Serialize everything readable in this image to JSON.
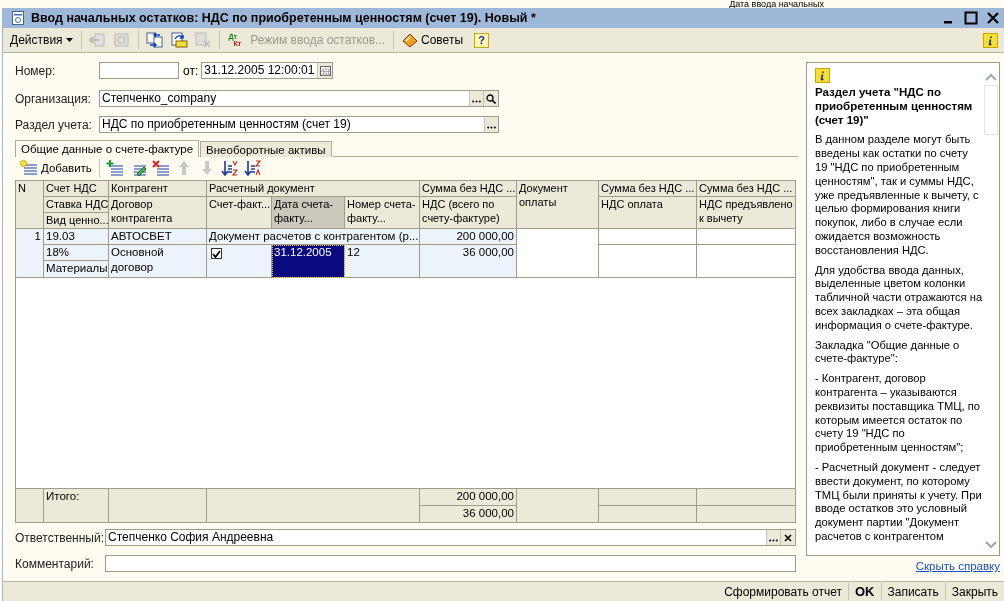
{
  "background_window": {
    "text": "Дата ввода начальных"
  },
  "window": {
    "title": "Ввод начальных остатков: НДС по приобретенным ценностям (счет 19). Новый *"
  },
  "toolbar": {
    "actions_menu": "Действия",
    "icon_buttons": [
      {
        "disabled": true
      },
      {
        "disabled": true
      },
      {
        "disabled": false
      },
      {
        "disabled": false
      },
      {
        "disabled": true
      }
    ],
    "posting_icon": [
      "Дт",
      "Кт"
    ],
    "mode_button": {
      "label": "Режим ввода остатков...",
      "disabled": true
    },
    "tips_button": "Советы",
    "help_button": "?"
  },
  "form": {
    "number": {
      "label": "Номер:"
    },
    "date": {
      "label": "от:",
      "value": "31.12.2005 12:00:01"
    },
    "organization": {
      "label": "Организация:",
      "value": "Степченко_company"
    },
    "section": {
      "label": "Раздел учета:",
      "value": "НДС по приобретенным ценностям (счет 19)"
    }
  },
  "tabs": [
    {
      "label": "Общие данные о счете-фактуре",
      "selected": true
    },
    {
      "label": "Внеоборотные активы",
      "selected": false
    }
  ],
  "table_toolbar": {
    "add_button": "Добавить",
    "icon_buttons": [
      {
        "disabled": false
      },
      {
        "disabled": false
      },
      {
        "disabled": false
      },
      {
        "disabled": true
      },
      {
        "disabled": true
      },
      {
        "disabled": false
      },
      {
        "disabled": false
      }
    ]
  },
  "table": {
    "header": [
      {
        "text": "N",
        "selected": false
      },
      {
        "text": "Счет НДС",
        "selected": false
      },
      {
        "text": "Контрагент",
        "selected": false
      },
      {
        "text": "Расчетный документ",
        "selected": false
      },
      {
        "text": "Сумма без НДС ...",
        "selected": false
      },
      {
        "text": "Документ оплаты",
        "selected": false
      },
      {
        "text": "Сумма без НДС ...",
        "selected": false
      },
      {
        "text": "Сумма без НДС ...",
        "selected": false
      },
      {
        "text": "Ставка НДС",
        "selected": false
      },
      {
        "text": "Вид ценно...",
        "selected": false
      },
      {
        "text": "Договор контрагента",
        "selected": false
      },
      {
        "text": "Счет-факт...",
        "selected": false
      },
      {
        "text": "Дата счета-факту...",
        "selected": true
      },
      {
        "text": "Номер счета-факту...",
        "selected": false
      },
      {
        "text": "НДС (всего по счету-фактуре)",
        "selected": false
      },
      {
        "text": "НДС оплата",
        "selected": false
      },
      {
        "text": "НДС предъявлено к вычету",
        "selected": false
      }
    ],
    "rows": [
      {
        "n": "1",
        "vat_account": "19.03",
        "vat_rate": "18%",
        "asset_type": "Материалы",
        "counterparty": "АВТОСВЕТ",
        "contract": "Основной договор",
        "settlement_document": "Документ расчетов с контрагентом (р...",
        "invoice_received": true,
        "invoice_date": {
          "text": "31.12.2005",
          "selected": true
        },
        "invoice_number": "12",
        "amount_without_vat": "200 000,00",
        "vat_total": "36 000,00"
      }
    ],
    "totals": {
      "label": "Итого:",
      "amount_without_vat": "200 000,00",
      "vat_total": "36 000,00"
    }
  },
  "responsible": {
    "label": "Ответственный:",
    "value": "Степченко София Андреевна"
  },
  "comment": {
    "label": "Комментарий:"
  },
  "help": {
    "title": "Раздел учета \"НДС по приобретенным ценностям (счет 19)\"",
    "paragraphs": [
      "В данном разделе могут быть введены как остатки по счету 19 \"НДС по приобретенным ценностям\", так и суммы НДС, уже предъявленные к вычету, с целью формирования книги покупок, либо в случае если ожидается возможность восстановления НДС.",
      "Для удобства ввода данных, выделенные цветом колонки табличной части отражаются на всех закладках – эта общая информация о счете-фактуре.",
      "Закладка \"Общие данные о счете-фактуре\":",
      "- Контрагент, договор контрагента – указываются реквизиты поставщика ТМЦ, по которым имеется остаток по счету 19 \"НДС по приобретенным ценностям\";",
      "- Расчетный документ - следует ввести документ, по которому ТМЦ были приняты к учету. При вводе остатков это условный документ партии \"Документ расчетов с контрагентом"
    ],
    "hide_link": "Скрыть справку"
  },
  "buttons": [
    {
      "label": "Сформировать отчет",
      "bold": false
    },
    {
      "label": "OK",
      "bold": true
    },
    {
      "label": "Записать",
      "bold": false
    },
    {
      "label": "Закрыть",
      "bold": false
    }
  ]
}
